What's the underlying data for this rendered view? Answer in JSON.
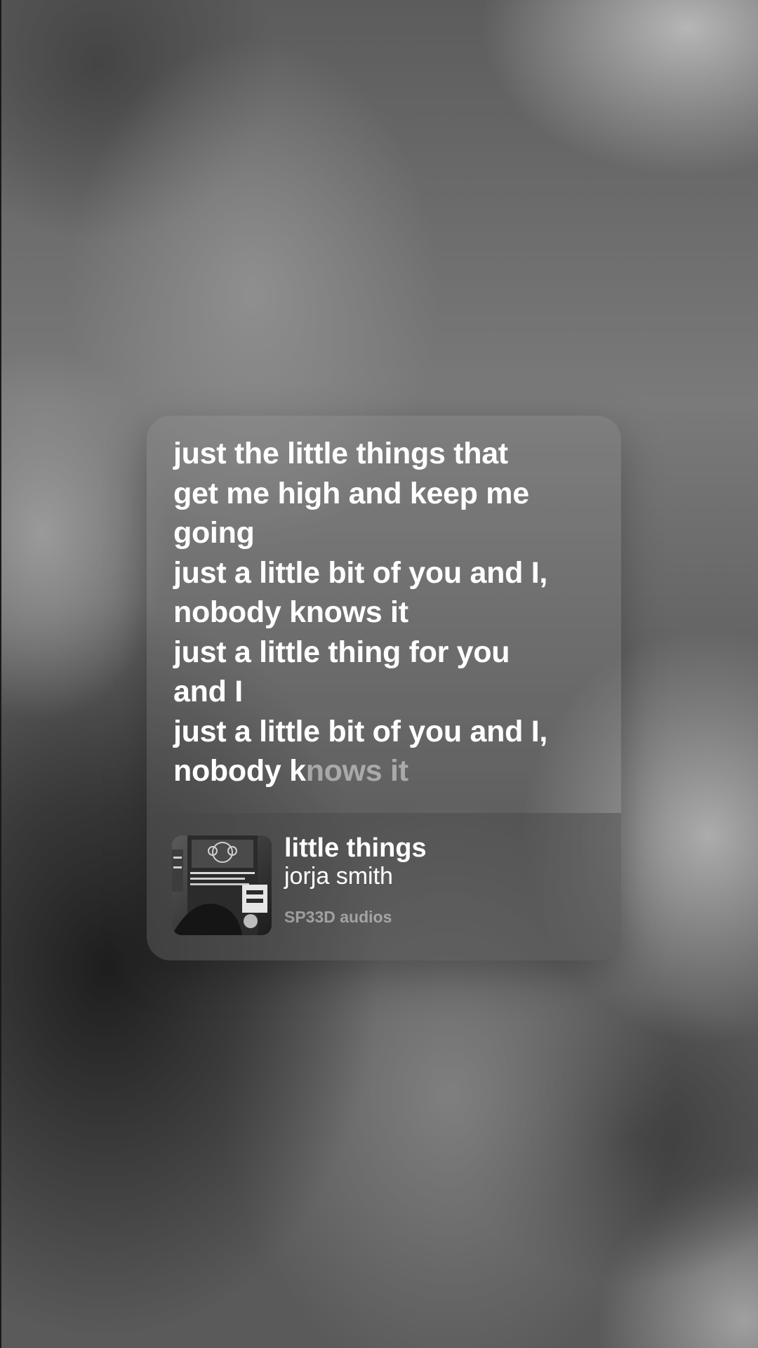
{
  "lyrics": {
    "lines": [
      "just the little things that",
      "get me high and keep me",
      "going",
      "just a little bit of you and I,",
      "nobody knows it",
      "just a little thing for you",
      "and I",
      "just a little bit of you and I,"
    ],
    "current_line_sung": "nobody k",
    "current_line_unsung": "nows it"
  },
  "track": {
    "title": "little things",
    "artist": "jorja smith",
    "source": "SP33D audios"
  },
  "icons": {
    "album_cover": "album-cover-image"
  },
  "colors": {
    "lyric_text": "#ffffff",
    "lyric_unsung": "#a8a8a8",
    "source_text": "#a3a3a3"
  }
}
